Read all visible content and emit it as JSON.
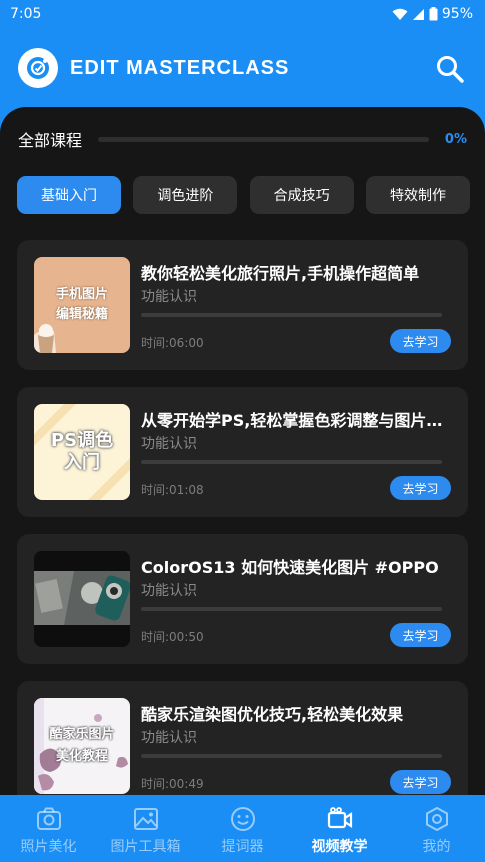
{
  "status": {
    "time": "7:05",
    "battery": "95%"
  },
  "header": {
    "brand": "EDIT MASTERCLASS"
  },
  "progress": {
    "label": "全部课程",
    "value_text": "0%",
    "percent": 0
  },
  "tabs": [
    {
      "label": "基础入门",
      "active": true
    },
    {
      "label": "调色进阶",
      "active": false
    },
    {
      "label": "合成技巧",
      "active": false
    },
    {
      "label": "特效制作",
      "active": false
    }
  ],
  "courses": [
    {
      "title": "教你轻松美化旅行照片,手机操作超简单",
      "subtitle": "功能认识",
      "time": "时间:06:00",
      "button": "去学习",
      "thumb_text": [
        "手机图片",
        "编辑秘籍"
      ]
    },
    {
      "title": "从零开始学PS,轻松掌握色彩调整与图片编辑",
      "subtitle": "功能认识",
      "time": "时间:01:08",
      "button": "去学习",
      "thumb_text": [
        "PS调色",
        "入门"
      ]
    },
    {
      "title": "ColorOS13 如何快速美化图片 #OPPO",
      "subtitle": "功能认识",
      "time": "时间:00:50",
      "button": "去学习",
      "thumb_text": []
    },
    {
      "title": "酷家乐渲染图优化技巧,轻松美化效果",
      "subtitle": "功能认识",
      "time": "时间:00:49",
      "button": "去学习",
      "thumb_text": [
        "酷家乐图片",
        "美化教程"
      ]
    }
  ],
  "nav": [
    {
      "label": "照片美化",
      "icon": "camera-icon",
      "active": false
    },
    {
      "label": "图片工具箱",
      "icon": "image-icon",
      "active": false
    },
    {
      "label": "提词器",
      "icon": "smile-icon",
      "active": false
    },
    {
      "label": "视频教学",
      "icon": "video-icon",
      "active": true
    },
    {
      "label": "我的",
      "icon": "profile-icon",
      "active": false
    }
  ],
  "colors": {
    "accent": "#1a8ef5",
    "button": "#2d8bf0",
    "panel": "#161616",
    "card": "#232323"
  }
}
